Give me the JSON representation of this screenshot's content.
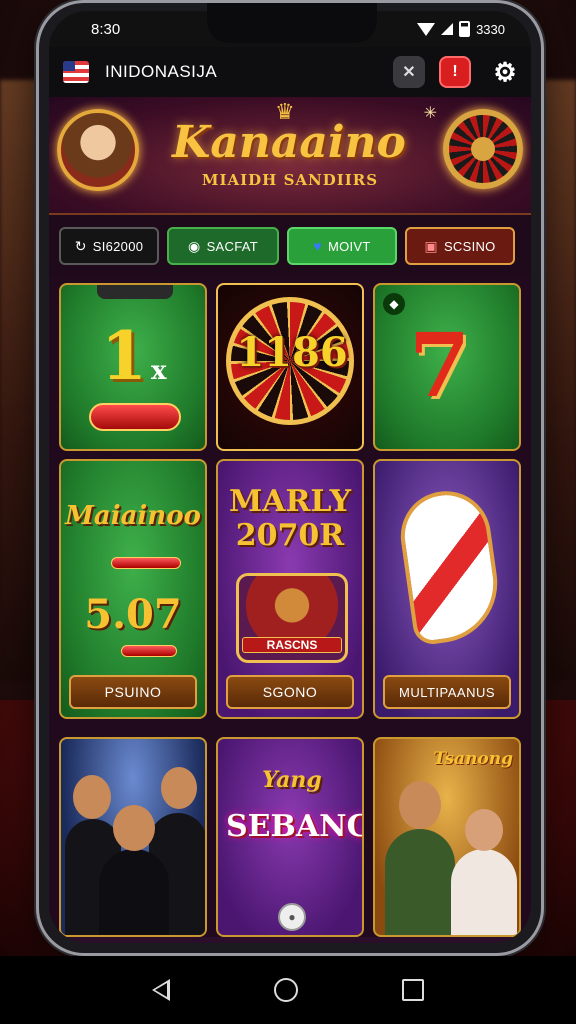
{
  "status": {
    "time": "8:30",
    "right_time": "3330"
  },
  "appbar": {
    "country": "INIDONASIJA",
    "icons": [
      "flag-icon",
      "tools-icon",
      "alert-icon",
      "gear-icon"
    ]
  },
  "hero": {
    "logo": "Kanaaino",
    "tagline": "MIAIDH SANDIIRS"
  },
  "tabs": [
    {
      "label": "SI62000",
      "icon": "refresh-icon"
    },
    {
      "label": "SACFAT",
      "icon": "football-icon"
    },
    {
      "label": "MOIVT",
      "icon": "heart-icon"
    },
    {
      "label": "SCSINO",
      "icon": "slot-icon"
    }
  ],
  "tiles": {
    "t1": {
      "text": "1",
      "suffix": "x"
    },
    "t2": {
      "text": "1186"
    },
    "t3": {
      "text": "7"
    },
    "t4": {
      "title": "Maiainoo",
      "amount": "5.07",
      "button": "PSUINO"
    },
    "t5": {
      "title": "MARLY 2070R",
      "emblem": "RASCNS",
      "button": "SGONO"
    },
    "t6": {
      "button": "MULTIPAANUS"
    },
    "t7": {},
    "t8": {
      "top": "Yang",
      "word": "SEBANG"
    },
    "t9": {
      "corner": "Tsanong"
    }
  },
  "colors": {
    "gold": "#f6c232",
    "green": "#2aa03a",
    "red": "#d81e1e",
    "purple": "#4a1670"
  }
}
